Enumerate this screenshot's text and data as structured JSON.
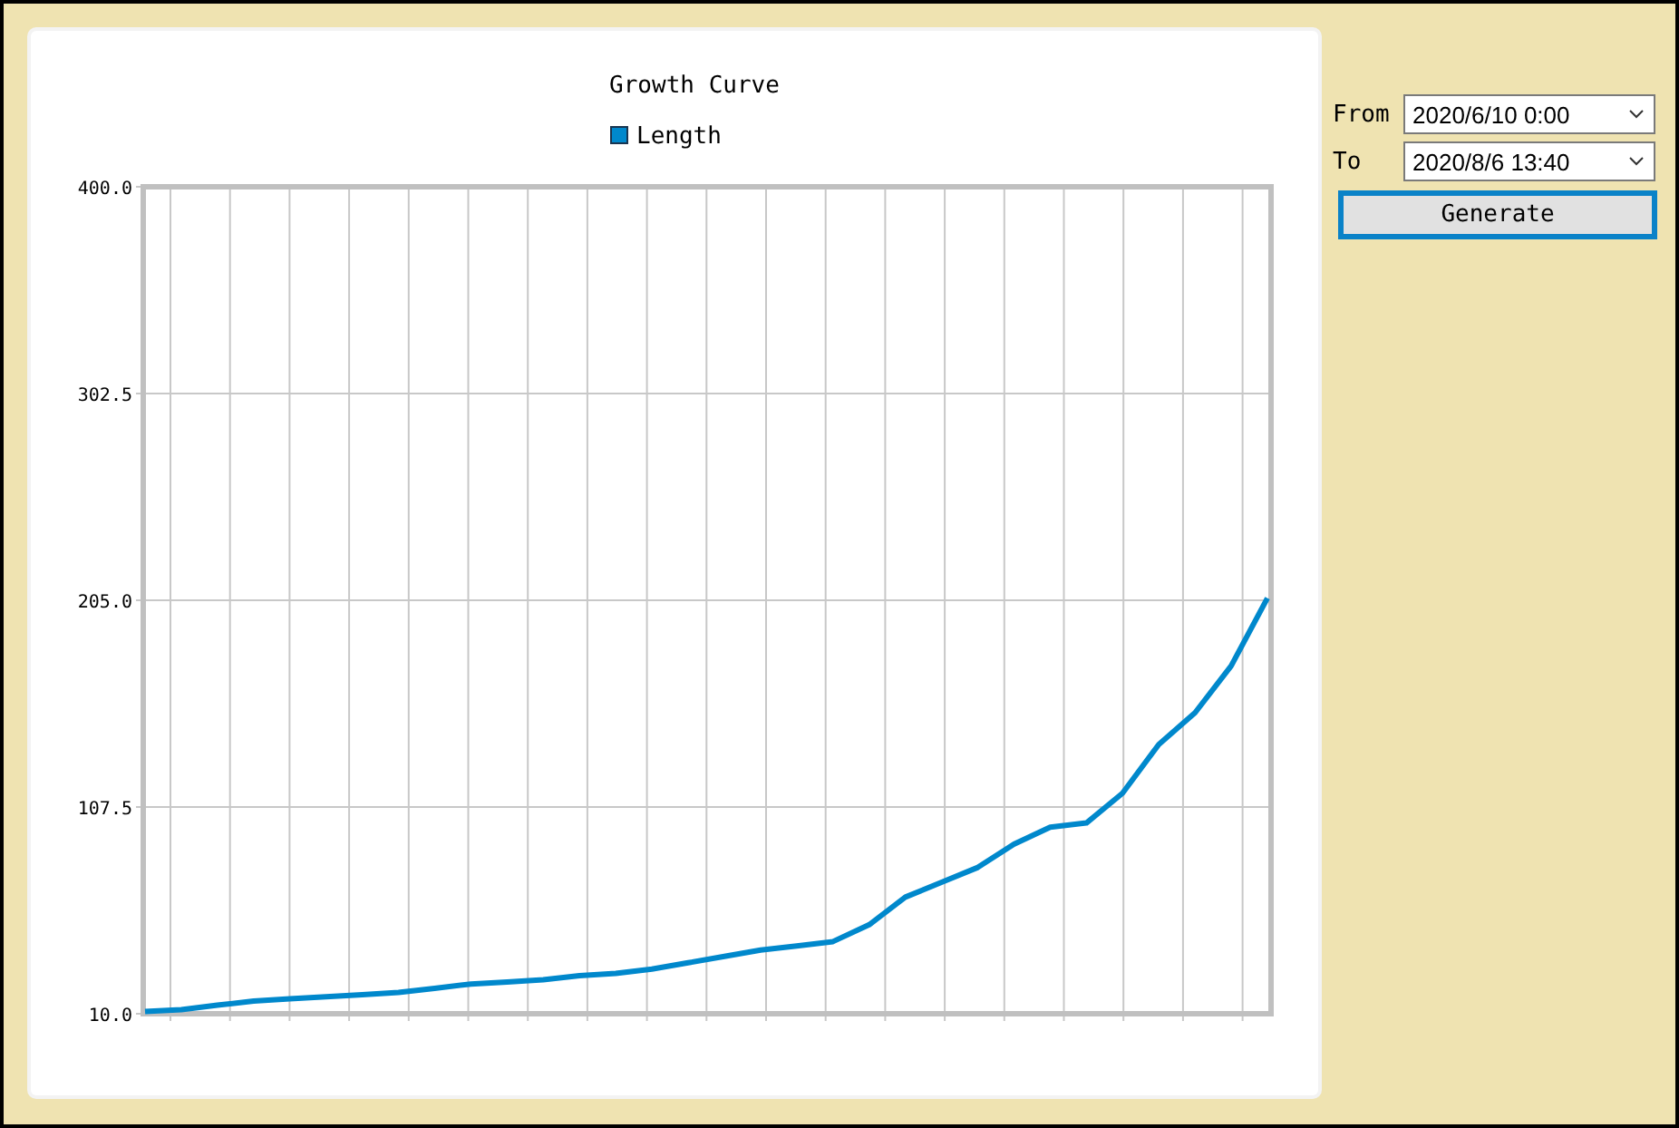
{
  "chart": {
    "chart_data": {
      "type": "line",
      "title": "Growth Curve",
      "grid": true,
      "ylim": [
        10,
        400
      ],
      "yticks": [
        {
          "value": 10,
          "label": "10.0"
        },
        {
          "value": 107.5,
          "label": "107.5"
        },
        {
          "value": 205,
          "label": "205.0"
        },
        {
          "value": 302.5,
          "label": "302.5"
        },
        {
          "value": 400,
          "label": "400.0"
        }
      ],
      "series": [
        {
          "name": "Length",
          "color": "#0088cc",
          "values": [
            11,
            12,
            14,
            16,
            17,
            18,
            19,
            20,
            22,
            24,
            25,
            26,
            28,
            29,
            31,
            34,
            37,
            40,
            42,
            44,
            52,
            65,
            72,
            79,
            90,
            98,
            100,
            114,
            137,
            152,
            174,
            206
          ]
        }
      ]
    }
  },
  "controls": {
    "from": {
      "label": "From",
      "value": "2020/6/10 0:00"
    },
    "to": {
      "label": "To",
      "value": "2020/8/6 13:40"
    },
    "button": "Generate"
  }
}
